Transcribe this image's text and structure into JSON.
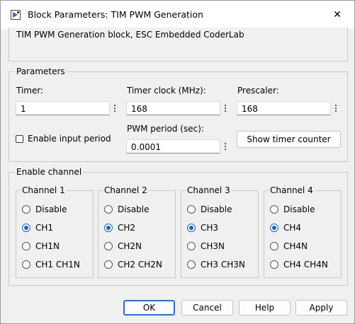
{
  "window": {
    "title": "Block Parameters: TIM PWM Generation",
    "close_glyph": "✕"
  },
  "description": "TIM PWM Generation block, ESC Embedded CoderLab",
  "parameters": {
    "group_label": "Parameters",
    "timer": {
      "label": "Timer:",
      "value": "1"
    },
    "timer_clock": {
      "label": "Timer clock (MHz):",
      "value": "168"
    },
    "prescaler": {
      "label": "Prescaler:",
      "value": "168"
    },
    "enable_input_period": {
      "label": "Enable input period",
      "checked": false
    },
    "pwm_period": {
      "label": "PWM period (sec):",
      "value": "0.0001"
    },
    "show_timer_counter": "Show timer counter"
  },
  "enable_channel": {
    "group_label": "Enable channel",
    "channels": [
      {
        "label": "Channel 1",
        "options": [
          "Disable",
          "CH1",
          "CH1N",
          "CH1 CH1N"
        ],
        "selected": 1
      },
      {
        "label": "Channel 2",
        "options": [
          "Disable",
          "CH2",
          "CH2N",
          "CH2 CH2N"
        ],
        "selected": 1
      },
      {
        "label": "Channel 3",
        "options": [
          "Disable",
          "CH3",
          "CH3N",
          "CH3 CH3N"
        ],
        "selected": 1
      },
      {
        "label": "Channel 4",
        "options": [
          "Disable",
          "CH4",
          "CH4N",
          "CH4 CH4N"
        ],
        "selected": 1
      }
    ]
  },
  "buttons": {
    "ok": "OK",
    "cancel": "Cancel",
    "help": "Help",
    "apply": "Apply"
  },
  "colors": {
    "accent": "#1a5fc8",
    "background": "#f0f0f0",
    "titlebar": "#ffffff"
  }
}
